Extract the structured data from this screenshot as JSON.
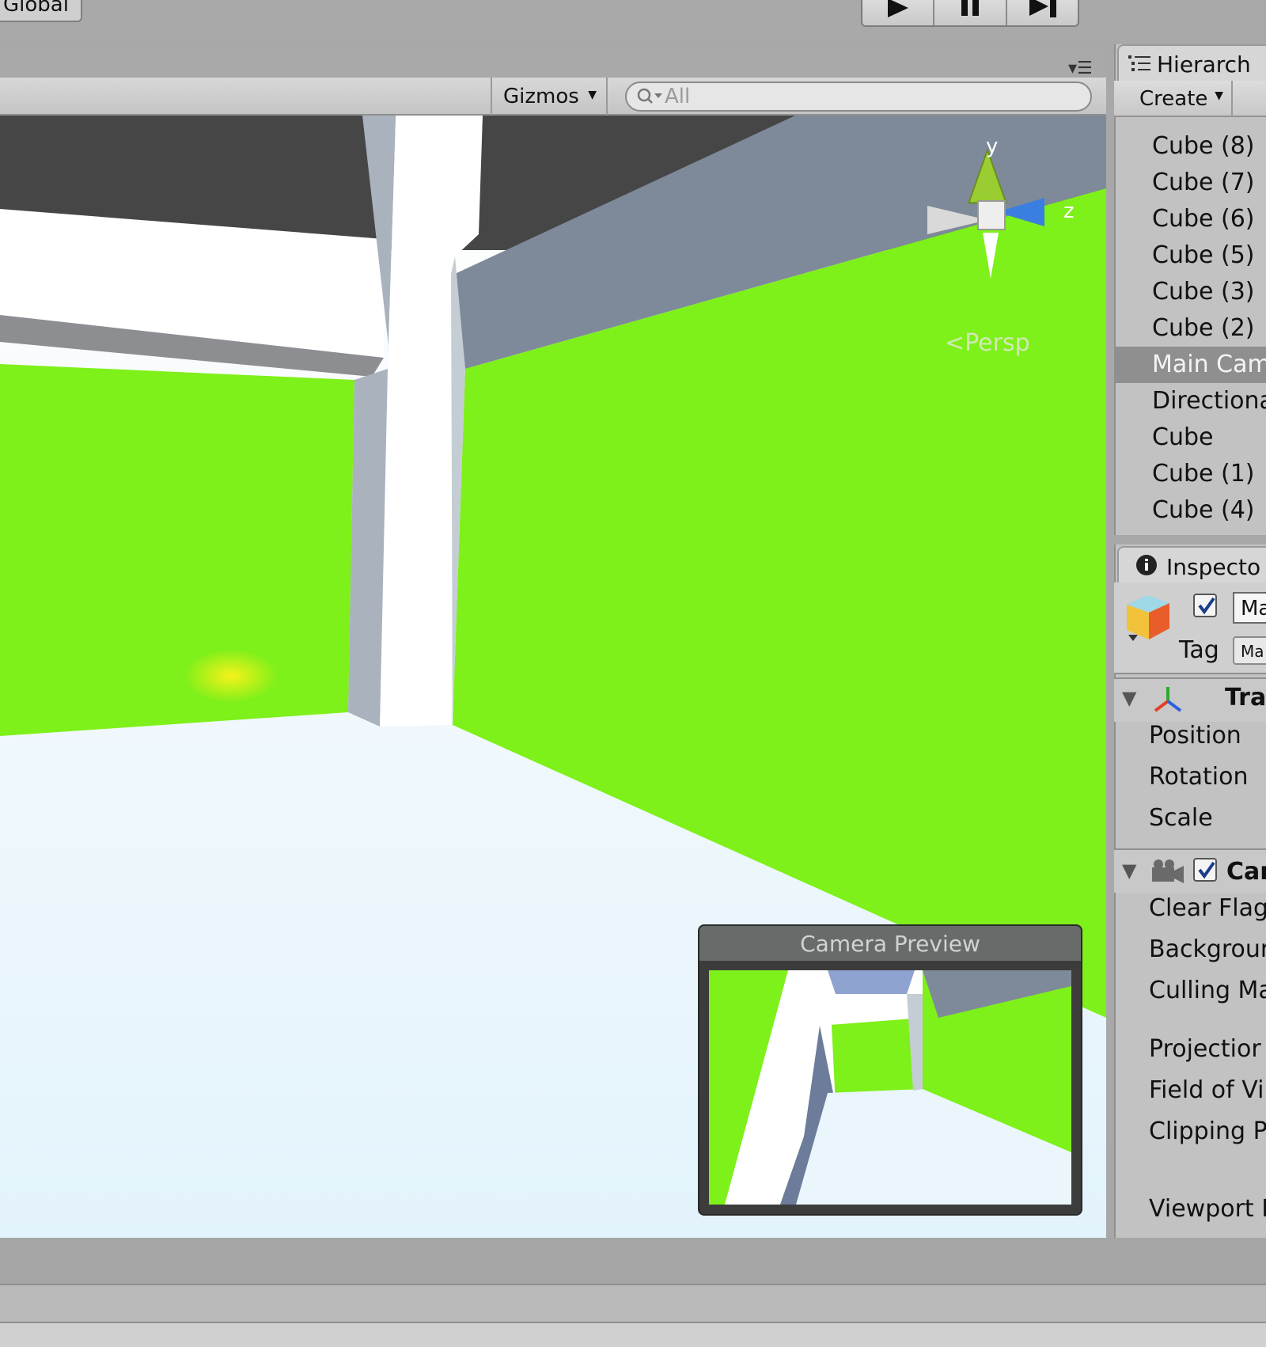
{
  "toolbar": {
    "global_label": "Global",
    "play_icon": "play-icon",
    "pause_icon": "pause-icon",
    "step_icon": "step-icon"
  },
  "scene": {
    "gizmos_label": "Gizmos",
    "search_placeholder": "All",
    "axis_y": "y",
    "axis_z": "z",
    "projection_label": "Persp",
    "camera_preview_title": "Camera Preview"
  },
  "hierarchy": {
    "tab_label": "Hierarch",
    "create_label": "Create",
    "items": [
      {
        "label": "Cube (8)",
        "selected": false
      },
      {
        "label": "Cube (7)",
        "selected": false
      },
      {
        "label": "Cube (6)",
        "selected": false
      },
      {
        "label": "Cube (5)",
        "selected": false
      },
      {
        "label": "Cube (3)",
        "selected": false
      },
      {
        "label": "Cube (2)",
        "selected": false
      },
      {
        "label": "Main Cam",
        "selected": true
      },
      {
        "label": "Directiona",
        "selected": false
      },
      {
        "label": "Cube",
        "selected": false
      },
      {
        "label": "Cube (1)",
        "selected": false
      },
      {
        "label": "Cube (4)",
        "selected": false
      }
    ]
  },
  "inspector": {
    "tab_label": "Inspecto",
    "name_value": "Ma",
    "tag_label": "Tag",
    "tag_value": "Ma",
    "transform": {
      "title": "Tra",
      "fields": [
        "Position",
        "Rotation",
        "Scale"
      ]
    },
    "camera": {
      "title": "Car",
      "fields": [
        "Clear Flag",
        "Backgrour",
        "Culling Ma",
        "Projectior",
        "Field of Vi",
        "Clipping P",
        "Viewport I"
      ]
    }
  },
  "colors": {
    "scene_green": "#7ef01a",
    "selection_gray": "#8f8f8f",
    "axis_y_green": "#9acd32",
    "axis_z_blue": "#3a7ee0"
  }
}
